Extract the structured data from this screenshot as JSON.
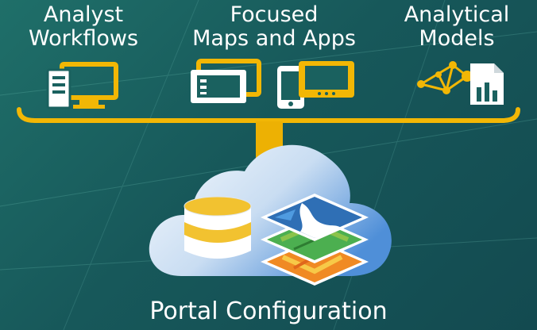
{
  "categories": [
    {
      "line1": "Analyst",
      "line2": "Workflows"
    },
    {
      "line1": "Focused",
      "line2": "Maps and Apps"
    },
    {
      "line1": "Analytical",
      "line2": "Models"
    }
  ],
  "footer": {
    "label": "Portal Configuration"
  },
  "icons": {
    "analyst": "desktop-monitor-icon",
    "maps_apps": [
      "tablet-landscape-icon",
      "phone-icon",
      "tablet-small-icon"
    ],
    "models": [
      "network-graph-icon",
      "report-chart-icon"
    ],
    "portal": [
      "cloud-icon",
      "database-icon",
      "map-layers-icon"
    ]
  },
  "colors": {
    "background": "#1a615f",
    "accent": "#f2b705",
    "text": "#ffffff",
    "cloud": "#dce8f5",
    "cloud_edge": "#4f8fd8",
    "database": "#f2c230"
  }
}
